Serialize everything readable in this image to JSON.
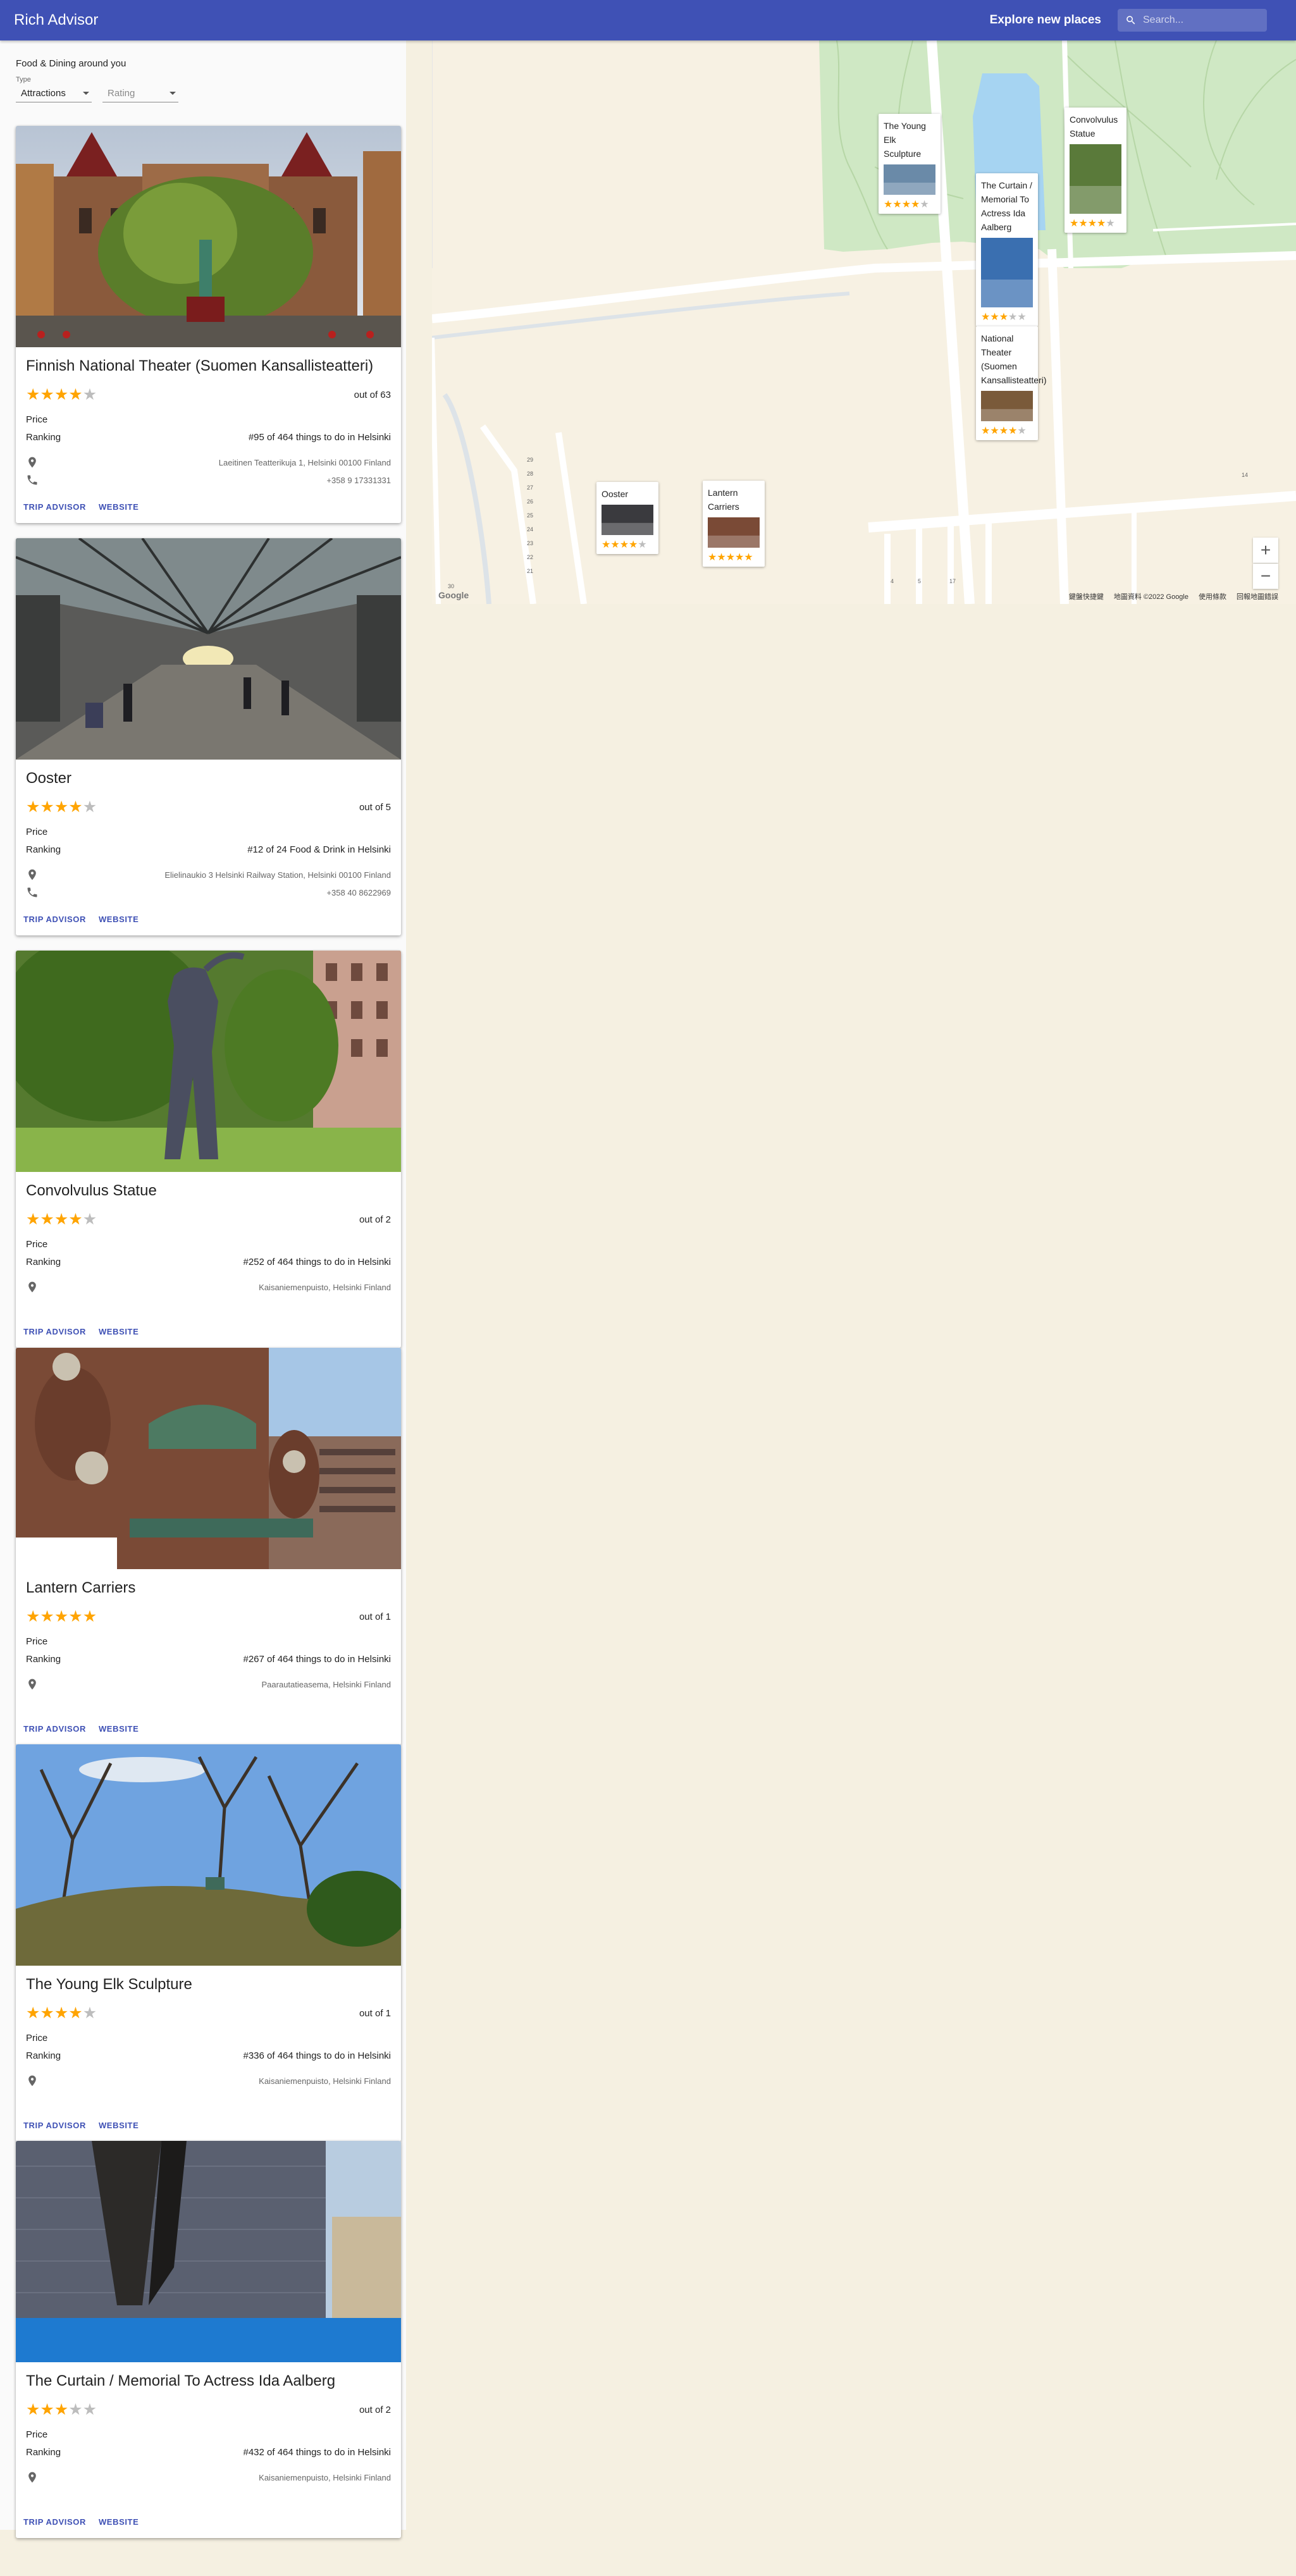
{
  "app": {
    "title": "Rich Advisor",
    "explore": "Explore new places",
    "search_placeholder": "Search..."
  },
  "panel": {
    "heading": "Food & Dining around you",
    "type_label": "Type",
    "type_value": "Attractions",
    "rating_placeholder": "Rating"
  },
  "cards": [
    {
      "name": "Finnish National Theater (Suomen Kansallisteatteri)",
      "rating": 4,
      "out_of": "out of 63",
      "price_label": "Price",
      "ranking_label": "Ranking",
      "ranking": "#95 of 464 things to do in Helsinki",
      "address": "Laeitinen Teatterikuja 1, Helsinki 00100 Finland",
      "phone": "+358 9 17331331",
      "trip": "TRIP ADVISOR",
      "web": "WEBSITE"
    },
    {
      "name": "Ooster",
      "rating": 4,
      "out_of": "out of 5",
      "price_label": "Price",
      "ranking_label": "Ranking",
      "ranking": "#12 of 24 Food & Drink in Helsinki",
      "address": "Eliel­inaukio 3 Helsinki Railway Station, Helsinki 00100 Finland",
      "phone": "+358 40 8622969",
      "trip": "TRIP ADVISOR",
      "web": "WEBSITE"
    },
    {
      "name": "Convolvulus Statue",
      "rating": 4,
      "out_of": "out of 2",
      "price_label": "Price",
      "ranking_label": "Ranking",
      "ranking": "#252 of 464 things to do in Helsinki",
      "address": "Kaisaniemenpuisto, Helsinki Finland",
      "trip": "TRIP ADVISOR",
      "web": "WEBSITE"
    },
    {
      "name": "Lantern Carriers",
      "rating": 5,
      "out_of": "out of 1",
      "price_label": "Price",
      "ranking_label": "Ranking",
      "ranking": "#267 of 464 things to do in Helsinki",
      "address": "Paarautatieasema, Helsinki Finland",
      "trip": "TRIP ADVISOR",
      "web": "WEBSITE"
    },
    {
      "name": "The Young Elk Sculpture",
      "rating": 4,
      "out_of": "out of 1",
      "price_label": "Price",
      "ranking_label": "Ranking",
      "ranking": "#336 of 464 things to do in Helsinki",
      "address": "Kaisaniemenpuisto, Helsinki Finland",
      "trip": "TRIP ADVISOR",
      "web": "WEBSITE"
    },
    {
      "name": "The Curtain / Memorial To Actress Ida Aalberg",
      "rating": 3,
      "out_of": "out of 2",
      "price_label": "Price",
      "ranking_label": "Ranking",
      "ranking": "#432 of 464 things to do in Helsinki",
      "address": "Kaisaniemenpuisto, Helsinki Finland",
      "trip": "TRIP ADVISOR",
      "web": "WEBSITE"
    }
  ],
  "map": {
    "markers": [
      {
        "name": "The Young Elk Sculpture",
        "rating": 4
      },
      {
        "name": "Convolvulus Statue",
        "rating": 4
      },
      {
        "name": "The Curtain / Memorial To Actress Ida Aalberg",
        "rating": 3
      },
      {
        "name": "National Theater (Suomen Kansallisteatteri)",
        "rating": 4
      },
      {
        "name": "Ooster",
        "rating": 4
      },
      {
        "name": "Lantern Carriers",
        "rating": 5
      }
    ],
    "zoom_in": "+",
    "zoom_out": "−",
    "google": "Google",
    "attribution": [
      "鍵盤快捷鍵",
      "地圖資料 ©2022 Google",
      "使用條款",
      "回報地圖錯誤"
    ],
    "street_numbers": [
      "29",
      "28",
      "27",
      "26",
      "25",
      "24",
      "23",
      "22",
      "21",
      "30",
      "14",
      "4",
      "5",
      "17"
    ]
  },
  "colors": {
    "primary": "#3f51b5",
    "star": "#ffa400",
    "park": "#cfe8c4",
    "water": "#a6d4f2"
  }
}
